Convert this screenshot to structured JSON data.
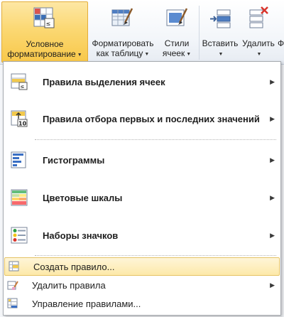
{
  "ribbon": {
    "conditional_formatting": "Условное форматирование",
    "conditional_formatting_line1": "Условное",
    "conditional_formatting_line2": "форматирование",
    "format_as_table_line1": "Форматировать",
    "format_as_table_line2": "как таблицу",
    "cell_styles_line1": "Стили",
    "cell_styles_line2": "ячеек",
    "insert": "Вставить",
    "delete": "Удалить",
    "format_partial": "Ф"
  },
  "menu": {
    "highlight_rules": "Правила выделения ячеек",
    "top_bottom_rules": "Правила отбора первых и последних значений",
    "data_bars": "Гистограммы",
    "color_scales": "Цветовые шкалы",
    "icon_sets": "Наборы значков",
    "new_rule": "Создать правило...",
    "clear_rules": "Удалить правила",
    "manage_rules": "Управление правилами..."
  },
  "colors": {
    "active_button": "#f8c84a",
    "hover_item": "#fde9a9",
    "icon_blue": "#2f5e9e"
  }
}
